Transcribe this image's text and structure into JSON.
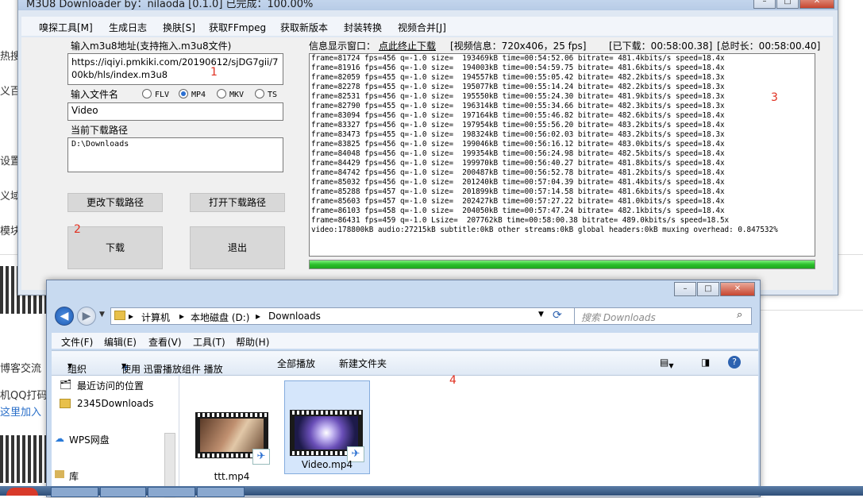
{
  "background_page": {
    "texts": [
      "热搜",
      "义百",
      "设置",
      "义域",
      "模块",
      "博客交流",
      "机QQ打码",
      "这里加入"
    ],
    "link_text": "这里"
  },
  "m3u8": {
    "title": "M3U8 Downloader   by：nilaoda [0.1.0]      已完成：100.00%",
    "menu": [
      "嗅探工具[M]",
      "生成日志",
      "换肤[S]",
      "获取FFmpeg",
      "获取新版本",
      "封装转换",
      "视频合并[J]"
    ],
    "url_label": "输入m3u8地址(支持拖入.m3u8文件)",
    "url_value_line1": "https://iqiyi.pmkiki.com/20190612/sjDG7gii/7",
    "url_value_line2": "00kb/hls/index.m3u8",
    "filename_label": "输入文件名",
    "formats": [
      "FLV",
      "MP4",
      "MKV",
      "TS"
    ],
    "format_selected": "MP4",
    "filename_value": "Video",
    "path_label": "当前下载路径",
    "path_value": "D:\\Downloads",
    "change_path_button": "更改下载路径",
    "open_path_button": "打开下载路径",
    "download_button": "下载",
    "exit_button": "退出",
    "info_label": "信息显示窗口：",
    "stop_link": "点此终止下载",
    "video_info": "[视频信息：720x406，25 fps]",
    "downloaded": "[已下载：00:58:00.38]",
    "total": "[总时长：00:58:00.40]",
    "annotations": [
      "1",
      "2",
      "3"
    ],
    "progress": 1.0,
    "log": [
      "frame=81724 fps=456 q=-1.0 size=  193469kB time=00:54:52.06 bitrate= 481.4kbits/s speed=18.4x",
      "frame=81916 fps=456 q=-1.0 size=  194003kB time=00:54:59.75 bitrate= 481.6kbits/s speed=18.4x",
      "frame=82059 fps=455 q=-1.0 size=  194557kB time=00:55:05.42 bitrate= 482.2kbits/s speed=18.3x",
      "frame=82278 fps=455 q=-1.0 size=  195077kB time=00:55:14.24 bitrate= 482.2kbits/s speed=18.3x",
      "frame=82531 fps=456 q=-1.0 size=  195550kB time=00:55:24.30 bitrate= 481.9kbits/s speed=18.3x",
      "frame=82790 fps=455 q=-1.0 size=  196314kB time=00:55:34.66 bitrate= 482.3kbits/s speed=18.3x",
      "frame=83094 fps=456 q=-1.0 size=  197164kB time=00:55:46.82 bitrate= 482.6kbits/s speed=18.4x",
      "frame=83327 fps=456 q=-1.0 size=  197954kB time=00:55:56.20 bitrate= 483.2kbits/s speed=18.4x",
      "frame=83473 fps=455 q=-1.0 size=  198324kB time=00:56:02.03 bitrate= 483.2kbits/s speed=18.3x",
      "frame=83825 fps=456 q=-1.0 size=  199046kB time=00:56:16.12 bitrate= 483.0kbits/s speed=18.4x",
      "frame=84048 fps=456 q=-1.0 size=  199354kB time=00:56:24.98 bitrate= 482.5kbits/s speed=18.4x",
      "frame=84429 fps=456 q=-1.0 size=  199970kB time=00:56:40.27 bitrate= 481.8kbits/s speed=18.4x",
      "frame=84742 fps=456 q=-1.0 size=  200487kB time=00:56:52.78 bitrate= 481.2kbits/s speed=18.4x",
      "frame=85032 fps=456 q=-1.0 size=  201240kB time=00:57:04.39 bitrate= 481.4kbits/s speed=18.4x",
      "frame=85288 fps=457 q=-1.0 size=  201899kB time=00:57:14.58 bitrate= 481.6kbits/s speed=18.4x",
      "frame=85603 fps=457 q=-1.0 size=  202427kB time=00:57:27.22 bitrate= 481.0kbits/s speed=18.4x",
      "frame=86103 fps=458 q=-1.0 size=  204050kB time=00:57:47.24 bitrate= 482.1kbits/s speed=18.4x",
      "frame=86431 fps=459 q=-1.0 Lsize=  207762kB time=00:58:00.38 bitrate= 489.0kbits/s speed=18.5x",
      "video:178800kB audio:27215kB subtitle:0kB other streams:0kB global headers:0kB muxing overhead: 0.847532%"
    ]
  },
  "explorer": {
    "breadcrumb": [
      "计算机",
      "本地磁盘 (D:)",
      "Downloads"
    ],
    "search_placeholder": "搜索 Downloads",
    "menu": [
      "文件(F)",
      "编辑(E)",
      "查看(V)",
      "工具(T)",
      "帮助(H)"
    ],
    "toolbar": [
      "组织",
      "使用 迅雷播放组件 播放",
      "全部播放",
      "新建文件夹"
    ],
    "nav": [
      "最近访问的位置",
      "2345Downloads",
      "WPS网盘",
      "库"
    ],
    "files": [
      "ttt.mp4",
      "Video.mp4"
    ],
    "annotation": "4"
  },
  "colors": {
    "progress_fill": "#2bc02b",
    "annotation_red": "#e03020",
    "window_frame": "#c8daf0"
  }
}
